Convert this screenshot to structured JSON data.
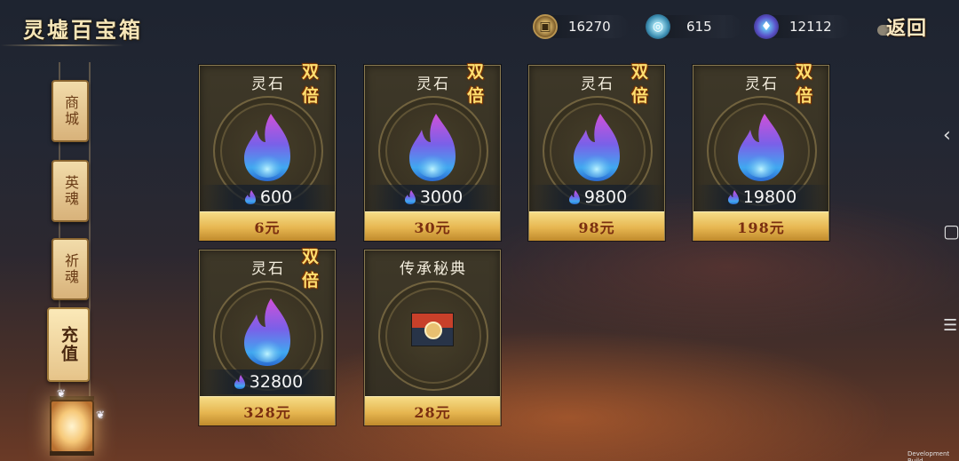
{
  "header": {
    "title": "灵墟百宝箱",
    "back_label": "返回"
  },
  "currencies": [
    {
      "icon": "coin-icon",
      "value": "16270"
    },
    {
      "icon": "jade-icon",
      "value": "615"
    },
    {
      "icon": "soul-flame-icon",
      "value": "12112"
    }
  ],
  "sidebar": {
    "tabs": [
      {
        "label": "商城",
        "active": false
      },
      {
        "label": "英魂",
        "active": false
      },
      {
        "label": "祈魂",
        "active": false
      },
      {
        "label": "充值",
        "active": true
      }
    ]
  },
  "products": [
    {
      "name": "灵石",
      "badge": "双倍",
      "amount": "600",
      "price": "6元"
    },
    {
      "name": "灵石",
      "badge": "双倍",
      "amount": "3000",
      "price": "30元"
    },
    {
      "name": "灵石",
      "badge": "双倍",
      "amount": "9800",
      "price": "98元"
    },
    {
      "name": "灵石",
      "badge": "双倍",
      "amount": "19800",
      "price": "198元"
    },
    {
      "name": "灵石",
      "badge": "双倍",
      "amount": "32800",
      "price": "328元"
    },
    {
      "name": "传承秘典",
      "badge": "",
      "amount": "",
      "price": "28元"
    }
  ],
  "system": {
    "back_glyph": "‹",
    "home_glyph": "▢",
    "menu_glyph": "☰",
    "dev_build": "Development Build"
  },
  "colors": {
    "price_gold": "#e6b650",
    "badge_yellow": "#ffdf70",
    "card_bg": "#3a3426"
  }
}
